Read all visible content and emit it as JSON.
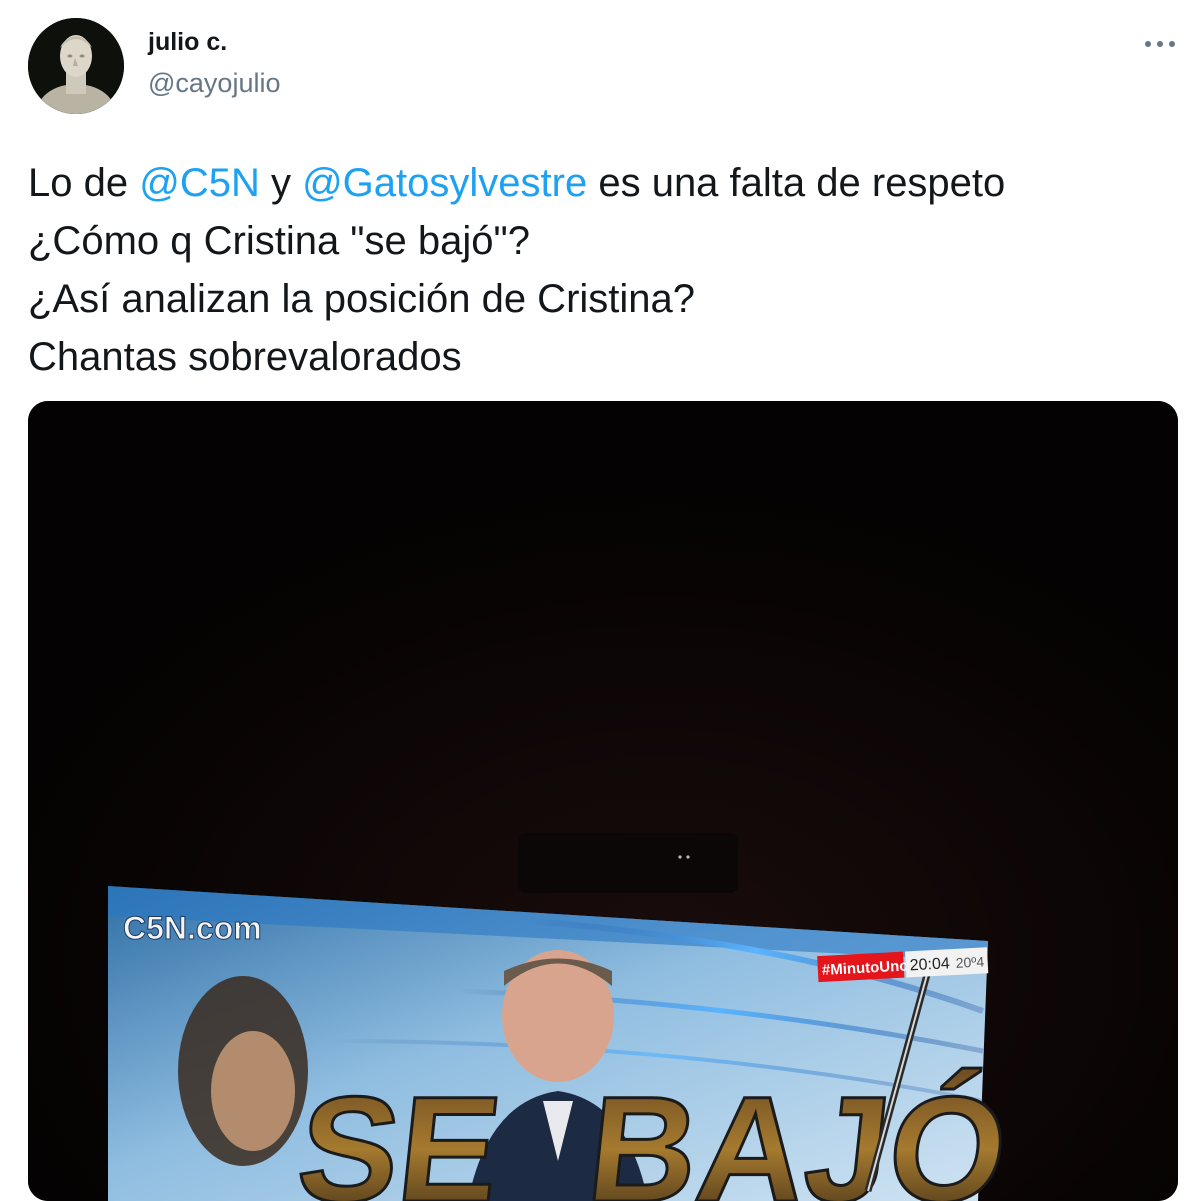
{
  "user": {
    "display_name": "julio c.",
    "handle": "@cayojulio",
    "avatar_icon": "bust-statue-avatar-icon"
  },
  "more_icon": "more-options-icon",
  "tweet": {
    "line1": {
      "prefix": "Lo de ",
      "mention1": "@C5N",
      "middle": " y ",
      "mention2": "@Gatosylvestre",
      "suffix": " es una falta de respeto"
    },
    "line2": "¿Cómo q Cristina \"se bajó\"?",
    "line3": "¿Así analizan la posición de Cristina?",
    "line4": "Chantas sobrevalorados"
  },
  "media": {
    "description_icon": "tv-screen-photo",
    "channel_logo": "C5N.com",
    "hashtag_badge": "#MinutoUno",
    "time": "20:04",
    "temperature": "20º4",
    "headline_fragment": "BAJÓ"
  },
  "colors": {
    "link": "#1da1f2",
    "secondary_text": "#657786",
    "primary_text": "#14171a",
    "badge_red": "#e4161c"
  }
}
